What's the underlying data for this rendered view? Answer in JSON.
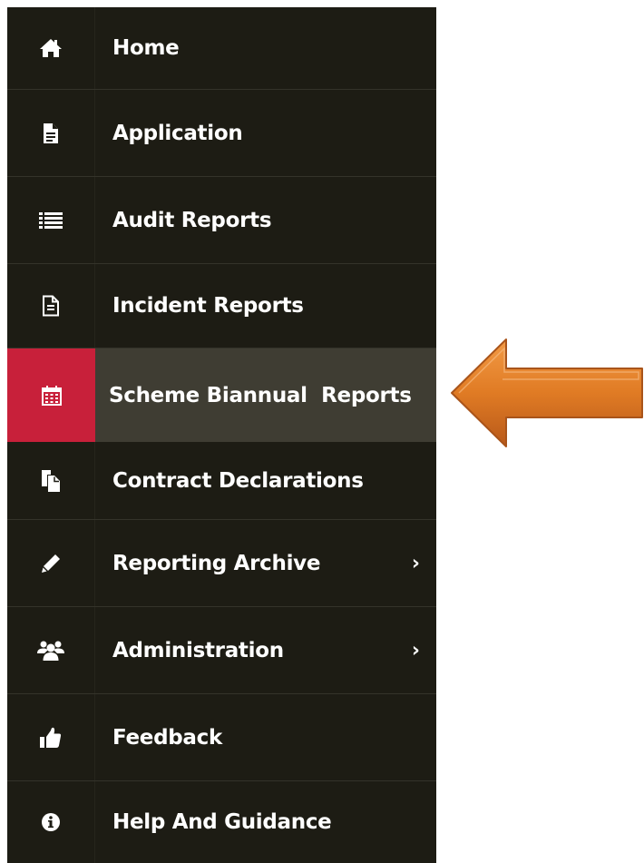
{
  "sidebar": {
    "items": [
      {
        "label": "Home",
        "icon": "home-icon"
      },
      {
        "label": "Application",
        "icon": "document-icon"
      },
      {
        "label": "Audit Reports",
        "icon": "list-icon"
      },
      {
        "label": "Incident Reports",
        "icon": "document-outline-icon"
      },
      {
        "label": "Scheme Biannual  Reports",
        "icon": "calendar-icon",
        "active": true
      },
      {
        "label": "Contract Declarations",
        "icon": "copy-icon"
      },
      {
        "label": "Reporting Archive",
        "icon": "pencil-icon",
        "submenu": true,
        "chevron": "›"
      },
      {
        "label": "Administration",
        "icon": "users-icon",
        "submenu": true,
        "chevron": "›"
      },
      {
        "label": "Feedback",
        "icon": "thumbs-up-icon"
      },
      {
        "label": "Help And Guidance",
        "icon": "info-icon"
      }
    ]
  },
  "colors": {
    "sidebar_bg": "#1d1c14",
    "active_item_bg": "#3f3d33",
    "active_icon_bg": "#c8203a",
    "arrow": "#e07b24"
  }
}
